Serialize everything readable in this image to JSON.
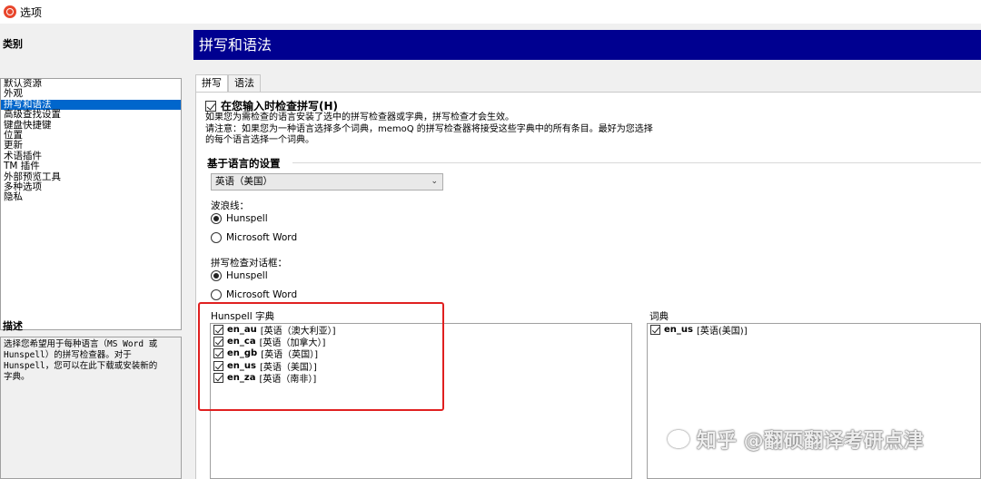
{
  "window": {
    "title": "选项"
  },
  "left": {
    "category_label": "类别",
    "categories": [
      "默认资源",
      "外观",
      "拼写和语法",
      "高级查找设置",
      "键盘快捷键",
      "位置",
      "更新",
      "术语插件",
      "TM 插件",
      "外部预览工具",
      "多种选项",
      "隐私"
    ],
    "selected_index": 2,
    "description_label": "描述",
    "description_lines": [
      "选择您希望用于每种语言（MS Word 或",
      "Hunspell）的拼写检查器。对于",
      "Hunspell，您可以在此下载或安装新的",
      "字典。"
    ]
  },
  "header": {
    "title": "拼写和语法"
  },
  "tabs": [
    {
      "label": "拼写",
      "active": true
    },
    {
      "label": "语法",
      "active": false
    }
  ],
  "spell": {
    "check_as_type_label": "在您输入时检查拼写(H)",
    "check_as_type_checked": true,
    "info_line1": "如果您为需检查的语言安装了选中的拼写检查器或字典，拼写检查才会生效。",
    "info_line2": "请注意：如果您为一种语言选择多个词典，memoQ 的拼写检查器将接受这些字典中的所有条目。最好为您选择",
    "info_line3": "的每个语言选择一个词典。",
    "lang_settings_title": "基于语言的设置",
    "language_value": "英语（美国）",
    "wavy_label": "波浪线：",
    "wavy_options": [
      "Hunspell",
      "Microsoft Word"
    ],
    "wavy_selected": 0,
    "dialog_label": "拼写检查对话框：",
    "dialog_options": [
      "Hunspell",
      "Microsoft Word"
    ],
    "dialog_selected": 0,
    "hunspell_label": "Hunspell 字典",
    "hunspell_dicts": [
      {
        "code": "en_au",
        "name": "[英语（澳大利亚）]",
        "checked": true
      },
      {
        "code": "en_ca",
        "name": "[英语（加拿大）]",
        "checked": true
      },
      {
        "code": "en_gb",
        "name": "[英语（英国）]",
        "checked": true
      },
      {
        "code": "en_us",
        "name": "[英语（美国）]",
        "checked": true
      },
      {
        "code": "en_za",
        "name": "[英语（南非）]",
        "checked": true
      }
    ],
    "dict_label": "词典",
    "dicts": [
      {
        "code": "en_us",
        "name": "[英语(美国)]",
        "checked": true
      }
    ]
  },
  "watermark": {
    "text": "知乎 @翻硕翻译考研点津"
  },
  "colors": {
    "header_bg": "#000090",
    "selection": "#0066cc",
    "highlight_border": "#e02020"
  }
}
